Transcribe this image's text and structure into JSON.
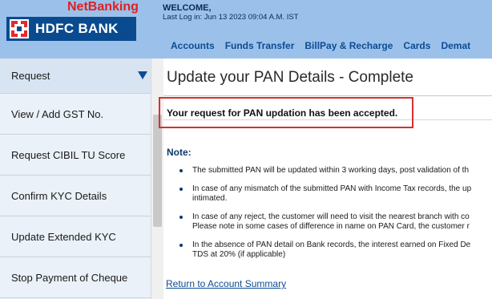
{
  "header": {
    "brand_top": "NetBanking",
    "brand_name": "HDFC BANK",
    "welcome": "WELCOME,",
    "last_login": "Last Log in: Jun 13 2023 09:04 A.M. IST",
    "nav": [
      "Accounts",
      "Funds Transfer",
      "BillPay & Recharge",
      "Cards",
      "Demat"
    ]
  },
  "sidebar": {
    "items": [
      {
        "label": "Request"
      },
      {
        "label": "View / Add GST No."
      },
      {
        "label": "Request CIBIL TU Score"
      },
      {
        "label": "Confirm KYC Details"
      },
      {
        "label": "Update Extended KYC"
      },
      {
        "label": "Stop Payment of Cheque"
      }
    ]
  },
  "main": {
    "title": "Update your PAN Details - Complete",
    "success_message": "Your request for PAN updation has been accepted.",
    "note_heading": "Note:",
    "notes": [
      "The submitted PAN will be updated within 3 working days, post validation of th",
      "In case of any mismatch of the submitted PAN with Income Tax records, the up\nintimated.",
      "In case of any reject, the customer will need to visit the nearest branch with co\nPlease note in some cases of difference in name on PAN Card, the customer r",
      "In the absence of PAN detail on Bank records, the interest earned on Fixed De\nTDS at 20% (if applicable)"
    ],
    "return_link": "Return to Account Summary"
  },
  "colors": {
    "header_bg": "#9bc1ea",
    "brand_blue": "#0a4b8f",
    "brand_red": "#e02020",
    "highlight_red": "#d9302c",
    "sidebar_bg": "#eaf1f8"
  }
}
